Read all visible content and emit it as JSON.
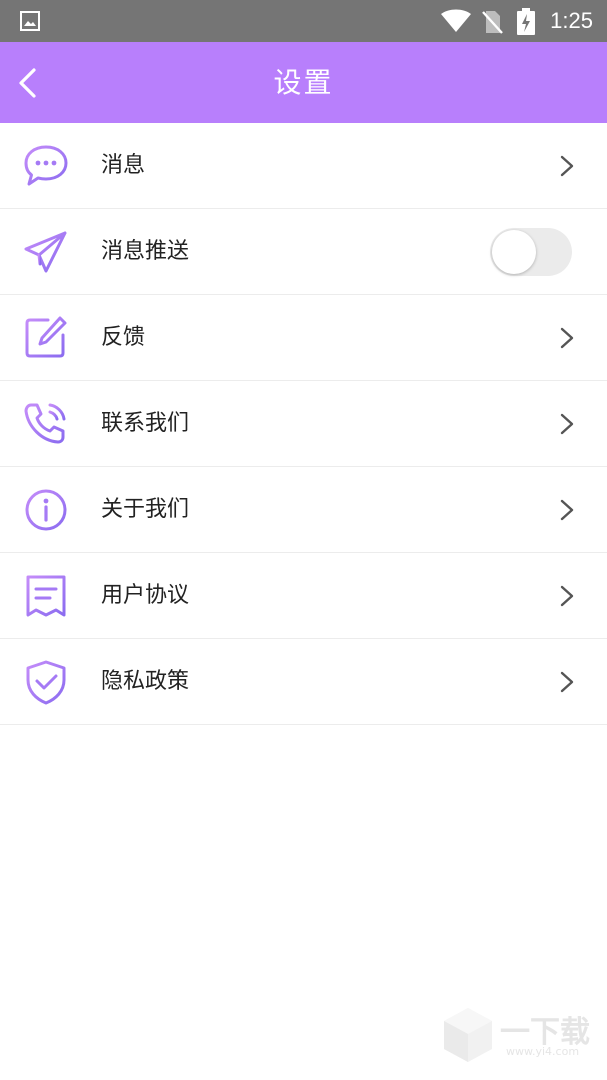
{
  "status_bar": {
    "time": "1:25",
    "icons": [
      "gallery-icon",
      "wifi-icon",
      "no-sim-icon",
      "battery-charging-icon"
    ]
  },
  "header": {
    "title": "设置",
    "back_icon": "back-arrow-icon",
    "background": "#b87ffc"
  },
  "accent_color": "#b07cf7",
  "settings": [
    {
      "label": "消息",
      "icon": "message-bubble-icon",
      "control": "chevron"
    },
    {
      "label": "消息推送",
      "icon": "paper-plane-icon",
      "control": "toggle",
      "enabled": false
    },
    {
      "label": "反馈",
      "icon": "edit-note-icon",
      "control": "chevron"
    },
    {
      "label": "联系我们",
      "icon": "phone-icon",
      "control": "chevron"
    },
    {
      "label": "关于我们",
      "icon": "info-icon",
      "control": "chevron"
    },
    {
      "label": "用户协议",
      "icon": "document-icon",
      "control": "chevron"
    },
    {
      "label": "隐私政策",
      "icon": "shield-check-icon",
      "control": "chevron"
    }
  ],
  "watermark": {
    "text": "一下载",
    "url": "www.yi4.com"
  }
}
